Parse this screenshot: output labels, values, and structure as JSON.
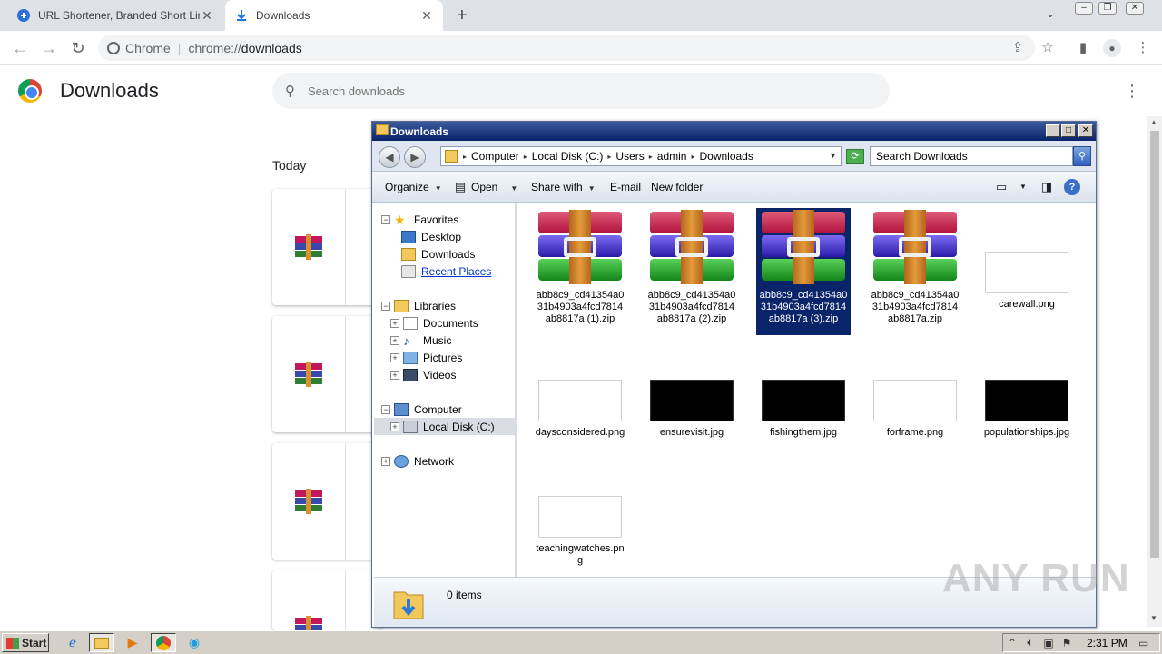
{
  "tabs": [
    {
      "title": "URL Shortener, Branded Short Links",
      "icon": "link-icon",
      "active": false
    },
    {
      "title": "Downloads",
      "icon": "download-icon",
      "active": true
    }
  ],
  "toolbar": {
    "site_label": "Chrome",
    "url_scheme": "chrome://",
    "url_path": "downloads"
  },
  "downloads_page": {
    "title": "Downloads",
    "search_placeholder": "Search downloads",
    "section": "Today"
  },
  "explorer": {
    "title": "Downloads",
    "breadcrumb": [
      "Computer",
      "Local Disk (C:)",
      "Users",
      "admin",
      "Downloads"
    ],
    "search_placeholder": "Search Downloads",
    "commands": {
      "organize": "Organize",
      "open": "Open",
      "share_with": "Share with",
      "email": "E-mail",
      "new_folder": "New folder"
    },
    "nav": {
      "favorites": "Favorites",
      "desktop": "Desktop",
      "downloads": "Downloads",
      "recent_places": "Recent Places",
      "libraries": "Libraries",
      "documents": "Documents",
      "music": "Music",
      "pictures": "Pictures",
      "videos": "Videos",
      "computer": "Computer",
      "local_disk": "Local Disk (C:)",
      "network": "Network"
    },
    "files": [
      {
        "name": "abb8c9_cd41354a031b4903a4fcd7814ab8817a (1).zip",
        "kind": "zip"
      },
      {
        "name": "abb8c9_cd41354a031b4903a4fcd7814ab8817a (2).zip",
        "kind": "zip"
      },
      {
        "name": "abb8c9_cd41354a031b4903a4fcd7814ab8817a (3).zip",
        "kind": "zip",
        "selected": true
      },
      {
        "name": "abb8c9_cd41354a031b4903a4fcd7814ab8817a.zip",
        "kind": "zip"
      },
      {
        "name": "carewall.png",
        "kind": "light"
      },
      {
        "name": "daysconsidered.png",
        "kind": "light"
      },
      {
        "name": "ensurevisit.jpg",
        "kind": "dark"
      },
      {
        "name": "fishingthem.jpg",
        "kind": "dark"
      },
      {
        "name": "forframe.png",
        "kind": "light"
      },
      {
        "name": "populationships.jpg",
        "kind": "dark"
      },
      {
        "name": "teachingwatches.png",
        "kind": "light"
      }
    ],
    "status": "0 items"
  },
  "taskbar": {
    "start": "Start",
    "clock": "2:31 PM"
  },
  "watermark": "ANY RUN"
}
